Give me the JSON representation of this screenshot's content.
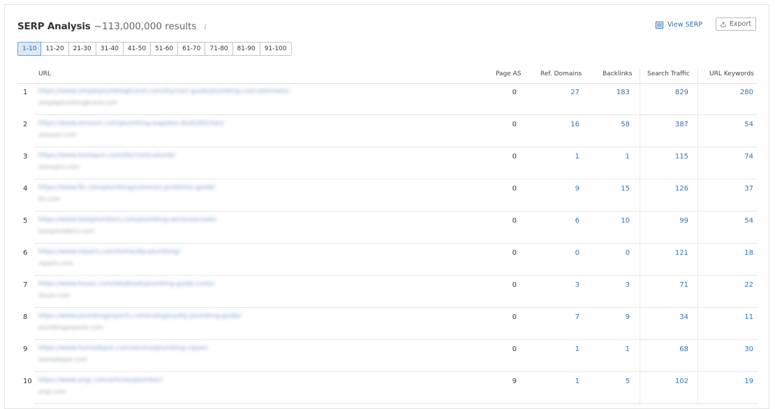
{
  "header": {
    "title": "SERP Analysis",
    "results": "~113,000,000 results",
    "info_icon": "i",
    "view_serp_label": "View SERP",
    "export_label": "Export"
  },
  "pagination": [
    "1-10",
    "11-20",
    "21-30",
    "31-40",
    "41-50",
    "51-60",
    "61-70",
    "71-80",
    "81-90",
    "91-100"
  ],
  "pagination_active": "1-10",
  "columns": {
    "url": "URL",
    "page_as": "Page AS",
    "ref_domains": "Ref. Domains",
    "backlinks": "Backlinks",
    "search_traffic": "Search Traffic",
    "url_keywords": "URL Keywords"
  },
  "rows": [
    {
      "rank": "1",
      "url": "https://www.simpleplumbingbrand.com/diy/cost-guide/plumbing-cost-estimator/",
      "domain": "simpleplumbingbrand.com",
      "page_as": "0",
      "ref_domains": "27",
      "backlinks": "183",
      "search_traffic": "829",
      "url_keywords": "280"
    },
    {
      "rank": "2",
      "url": "https://www.amazon.com/plumbing-supplies-deals/kitchen/",
      "domain": "amazon.com",
      "page_as": "0",
      "ref_domains": "16",
      "backlinks": "58",
      "search_traffic": "387",
      "url_keywords": "54"
    },
    {
      "rank": "3",
      "url": "https://www.homepro.com/diy/costs-plumb/",
      "domain": "homepro.com",
      "page_as": "0",
      "ref_domains": "1",
      "backlinks": "1",
      "search_traffic": "115",
      "url_keywords": "74"
    },
    {
      "rank": "4",
      "url": "https://www.fix.com/plumbing/common-problems-guide/",
      "domain": "fix.com",
      "page_as": "0",
      "ref_domains": "9",
      "backlinks": "15",
      "search_traffic": "126",
      "url_keywords": "37"
    },
    {
      "rank": "5",
      "url": "https://www.bestplumbers.com/plumbing-services/costs/",
      "domain": "bestplumbers.com",
      "page_as": "0",
      "ref_domains": "6",
      "backlinks": "10",
      "search_traffic": "99",
      "url_keywords": "54"
    },
    {
      "rank": "6",
      "url": "https://www.repairs.com/home/diy-plumbing/",
      "domain": "repairs.com",
      "page_as": "0",
      "ref_domains": "0",
      "backlinks": "0",
      "search_traffic": "121",
      "url_keywords": "18"
    },
    {
      "rank": "7",
      "url": "https://www.houzz.com/ideabook/plumbing-guide-costs/",
      "domain": "houzz.com",
      "page_as": "0",
      "ref_domains": "3",
      "backlinks": "3",
      "search_traffic": "71",
      "url_keywords": "22"
    },
    {
      "rank": "8",
      "url": "https://www.plumbingexperts.com/category/diy-plumbing-guide/",
      "domain": "plumbingexperts.com",
      "page_as": "0",
      "ref_domains": "7",
      "backlinks": "9",
      "search_traffic": "34",
      "url_keywords": "11"
    },
    {
      "rank": "9",
      "url": "https://www.homedepot.com/service/plumbing-repair/",
      "domain": "homedepot.com",
      "page_as": "0",
      "ref_domains": "1",
      "backlinks": "1",
      "search_traffic": "68",
      "url_keywords": "30"
    },
    {
      "rank": "10",
      "url": "https://www.angi.com/articles/plumber/",
      "domain": "angi.com",
      "page_as": "9",
      "ref_domains": "1",
      "backlinks": "5",
      "search_traffic": "102",
      "url_keywords": "19"
    }
  ],
  "colors": {
    "link": "#2f73b1",
    "active_page_bg": "#dbe9f6",
    "active_page_border": "#6fa3d3",
    "text": "#333333"
  }
}
